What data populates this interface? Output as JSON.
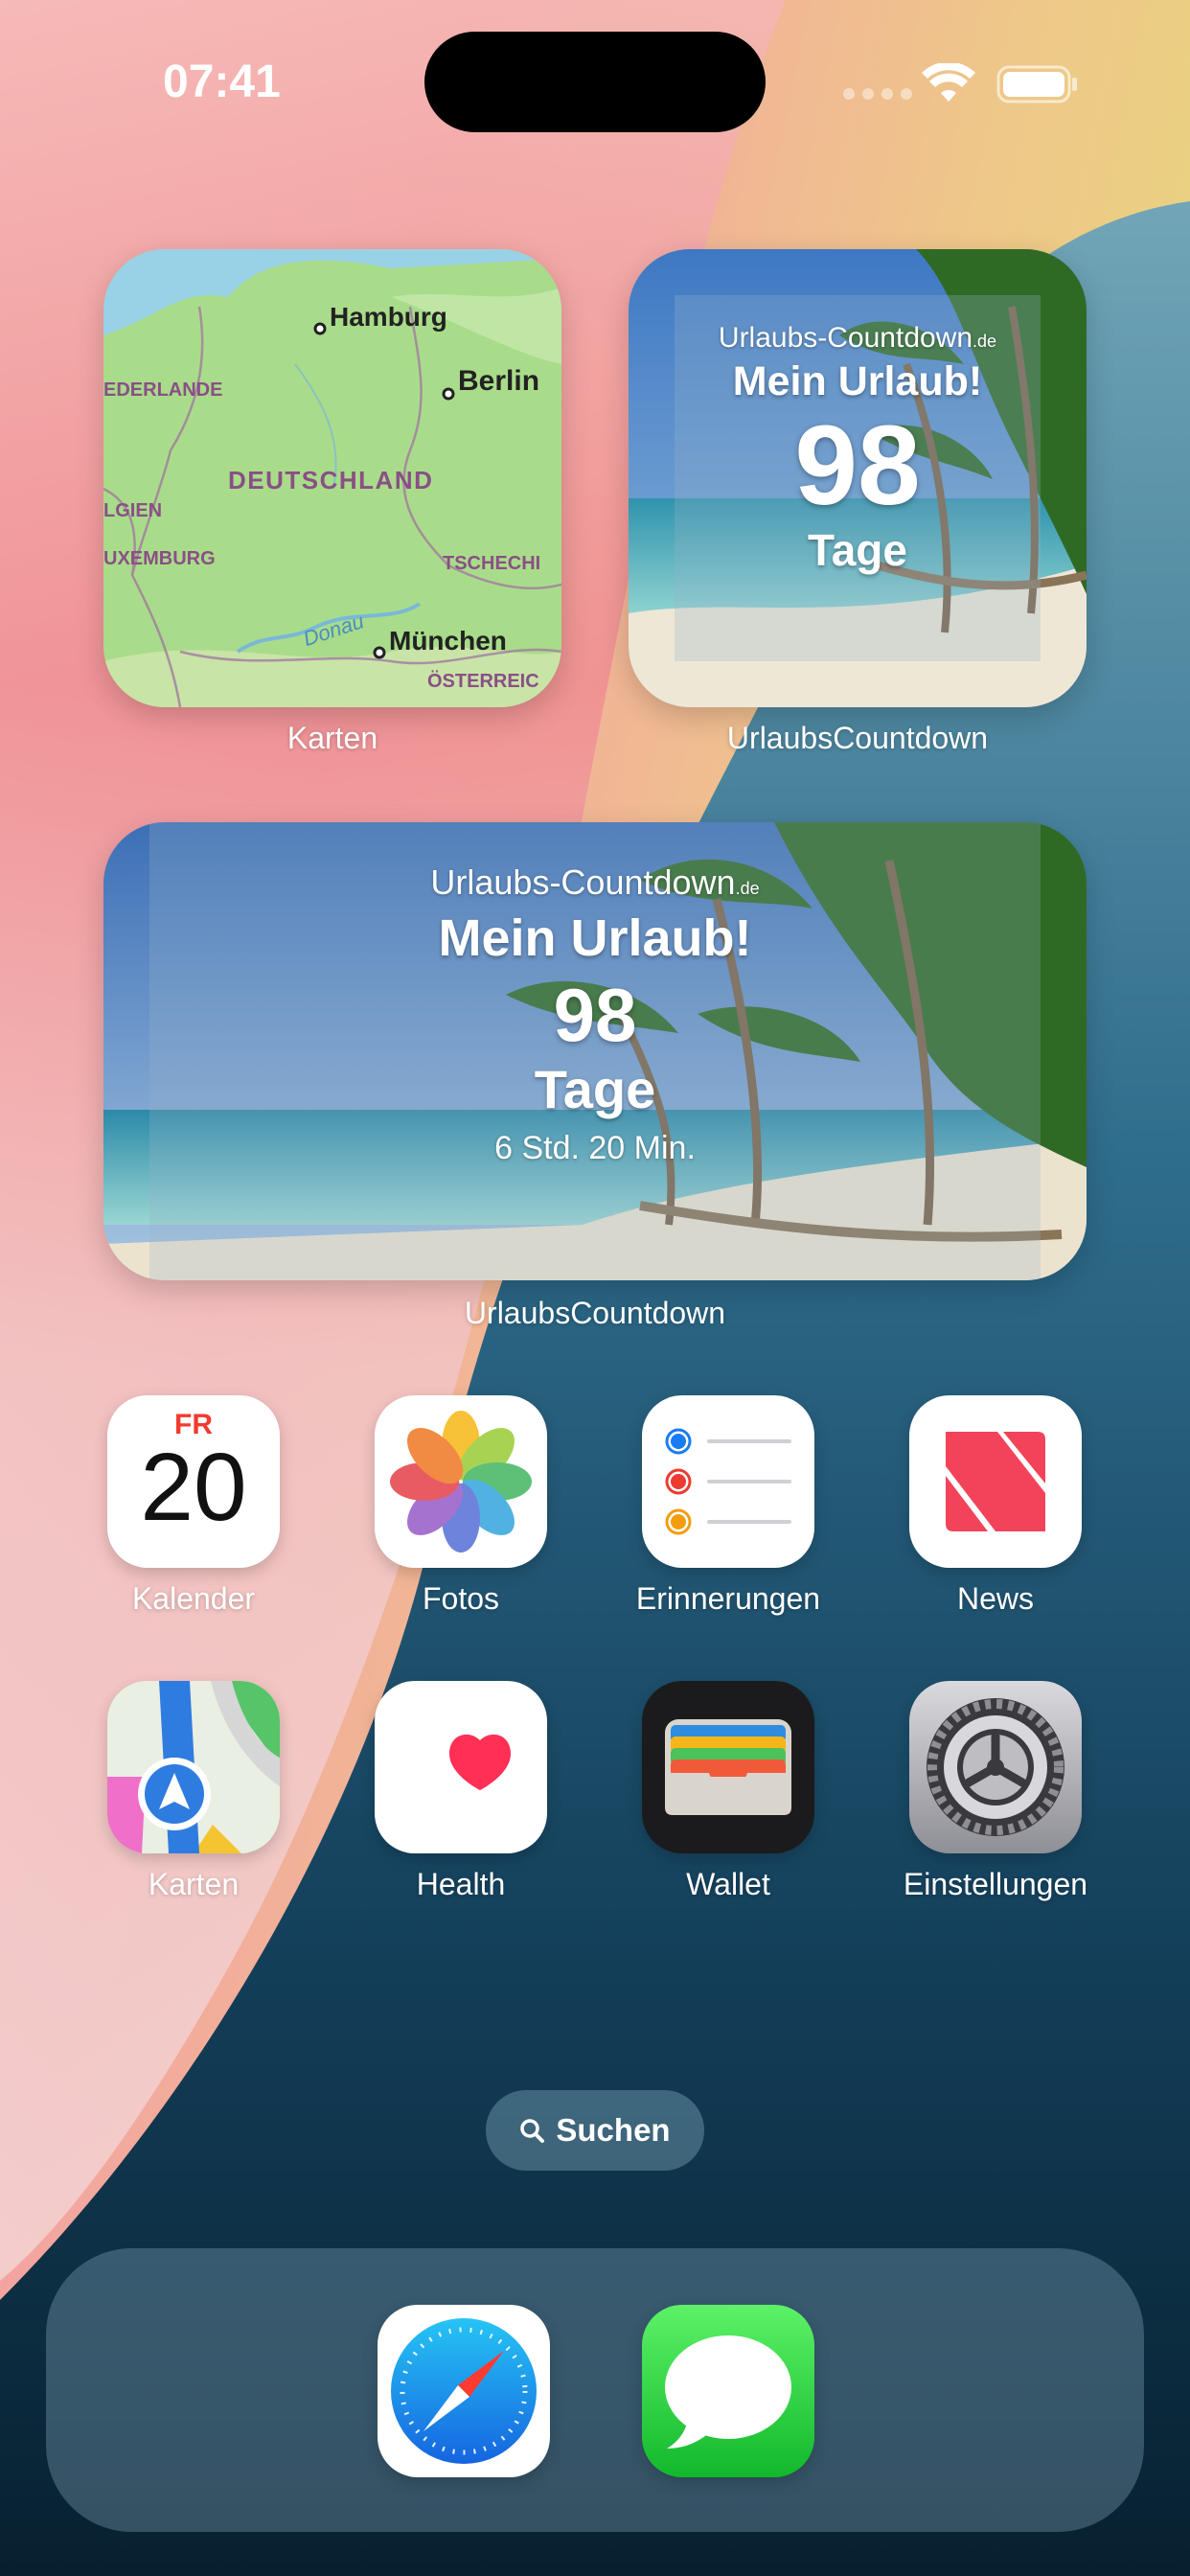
{
  "status_bar": {
    "time": "07:41"
  },
  "widgets": {
    "maps": {
      "label": "Karten",
      "places": {
        "hamburg": "Hamburg",
        "berlin": "Berlin",
        "niederlande": "EDERLANDE",
        "deutschland": "DEUTSCHLAND",
        "belgien": "LGIEN",
        "luxemburg": "UXEMBURG",
        "tschechien": "TSCHECHI",
        "donau": "Donau",
        "muenchen": "München",
        "oesterreich": "ÖSTERREIC"
      }
    },
    "countdown_small": {
      "label": "UrlaubsCountdown",
      "brand": "Urlaubs-Countdown",
      "brand_suffix": ".de",
      "title": "Mein Urlaub!",
      "days": "98",
      "unit": "Tage"
    },
    "countdown_medium": {
      "label": "UrlaubsCountdown",
      "brand": "Urlaubs-Countdown",
      "brand_suffix": ".de",
      "title": "Mein Urlaub!",
      "days": "98",
      "unit": "Tage",
      "remainder": "6 Std. 20 Min."
    }
  },
  "apps": [
    {
      "label": "Kalender",
      "weekday": "FR",
      "day": "20"
    },
    {
      "label": "Fotos"
    },
    {
      "label": "Erinnerungen"
    },
    {
      "label": "News"
    },
    {
      "label": "Karten"
    },
    {
      "label": "Health"
    },
    {
      "label": "Wallet"
    },
    {
      "label": "Einstellungen"
    }
  ],
  "search": {
    "label": "Suchen"
  },
  "dock": [
    "Safari",
    "Nachrichten"
  ]
}
